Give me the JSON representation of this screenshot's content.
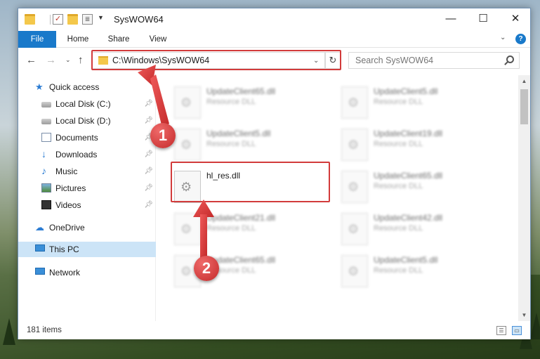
{
  "window": {
    "title": "SysWOW64",
    "minimize_glyph": "—",
    "maximize_glyph": "☐",
    "close_glyph": "✕"
  },
  "ribbon": {
    "tabs": [
      {
        "label": "File"
      },
      {
        "label": "Home"
      },
      {
        "label": "Share"
      },
      {
        "label": "View"
      }
    ],
    "help_glyph": "?"
  },
  "navigation": {
    "back_glyph": "←",
    "forward_glyph": "→",
    "recent_glyph": "⌄",
    "up_glyph": "↑"
  },
  "address_bar": {
    "path": "C:\\Windows\\SysWOW64",
    "refresh_glyph": "↻"
  },
  "search": {
    "placeholder": "Search SysWOW64"
  },
  "sidebar": {
    "items": [
      {
        "label": "Quick access",
        "icon": "star-icon",
        "pinned": false
      },
      {
        "label": "Local Disk (C:)",
        "icon": "disk-icon",
        "pinned": true
      },
      {
        "label": "Local Disk (D:)",
        "icon": "disk-icon",
        "pinned": true
      },
      {
        "label": "Documents",
        "icon": "documents-icon",
        "pinned": true
      },
      {
        "label": "Downloads",
        "icon": "downloads-icon",
        "pinned": true
      },
      {
        "label": "Music",
        "icon": "music-icon",
        "pinned": true
      },
      {
        "label": "Pictures",
        "icon": "pictures-icon",
        "pinned": true
      },
      {
        "label": "Videos",
        "icon": "videos-icon",
        "pinned": true
      },
      {
        "label": "OneDrive",
        "icon": "onedrive-icon",
        "pinned": false
      },
      {
        "label": "This PC",
        "icon": "pc-icon",
        "pinned": false,
        "selected": true
      },
      {
        "label": "Network",
        "icon": "network-icon",
        "pinned": false
      }
    ]
  },
  "files": [
    {
      "name": "UpdateClient65.dll",
      "type": "Resource DLL",
      "blurred": true
    },
    {
      "name": "UpdateClient5.dll",
      "type": "Resource DLL",
      "blurred": true
    },
    {
      "name": "UpdateClient5.dll",
      "type": "Resource DLL",
      "blurred": true
    },
    {
      "name": "UpdateClient19.dll",
      "type": "Resource DLL",
      "blurred": true
    },
    {
      "name": "hl_res.dll",
      "type": "",
      "blurred": false
    },
    {
      "name": "UpdateClient65.dll",
      "type": "Resource DLL",
      "blurred": true
    },
    {
      "name": "UpdateClient21.dll",
      "type": "Resource DLL",
      "blurred": true
    },
    {
      "name": "UpdateClient42.dll",
      "type": "Resource DLL",
      "blurred": true
    },
    {
      "name": "UpdateClient65.dll",
      "type": "Resource DLL",
      "blurred": true
    },
    {
      "name": "UpdateClient5.dll",
      "type": "Resource DLL",
      "blurred": true
    }
  ],
  "status": {
    "item_count": "181 items"
  },
  "callouts": [
    {
      "number": "1"
    },
    {
      "number": "2"
    }
  ],
  "colors": {
    "accent": "#1979ca",
    "highlight": "#d23b3b",
    "callout": "#d23b3b"
  }
}
